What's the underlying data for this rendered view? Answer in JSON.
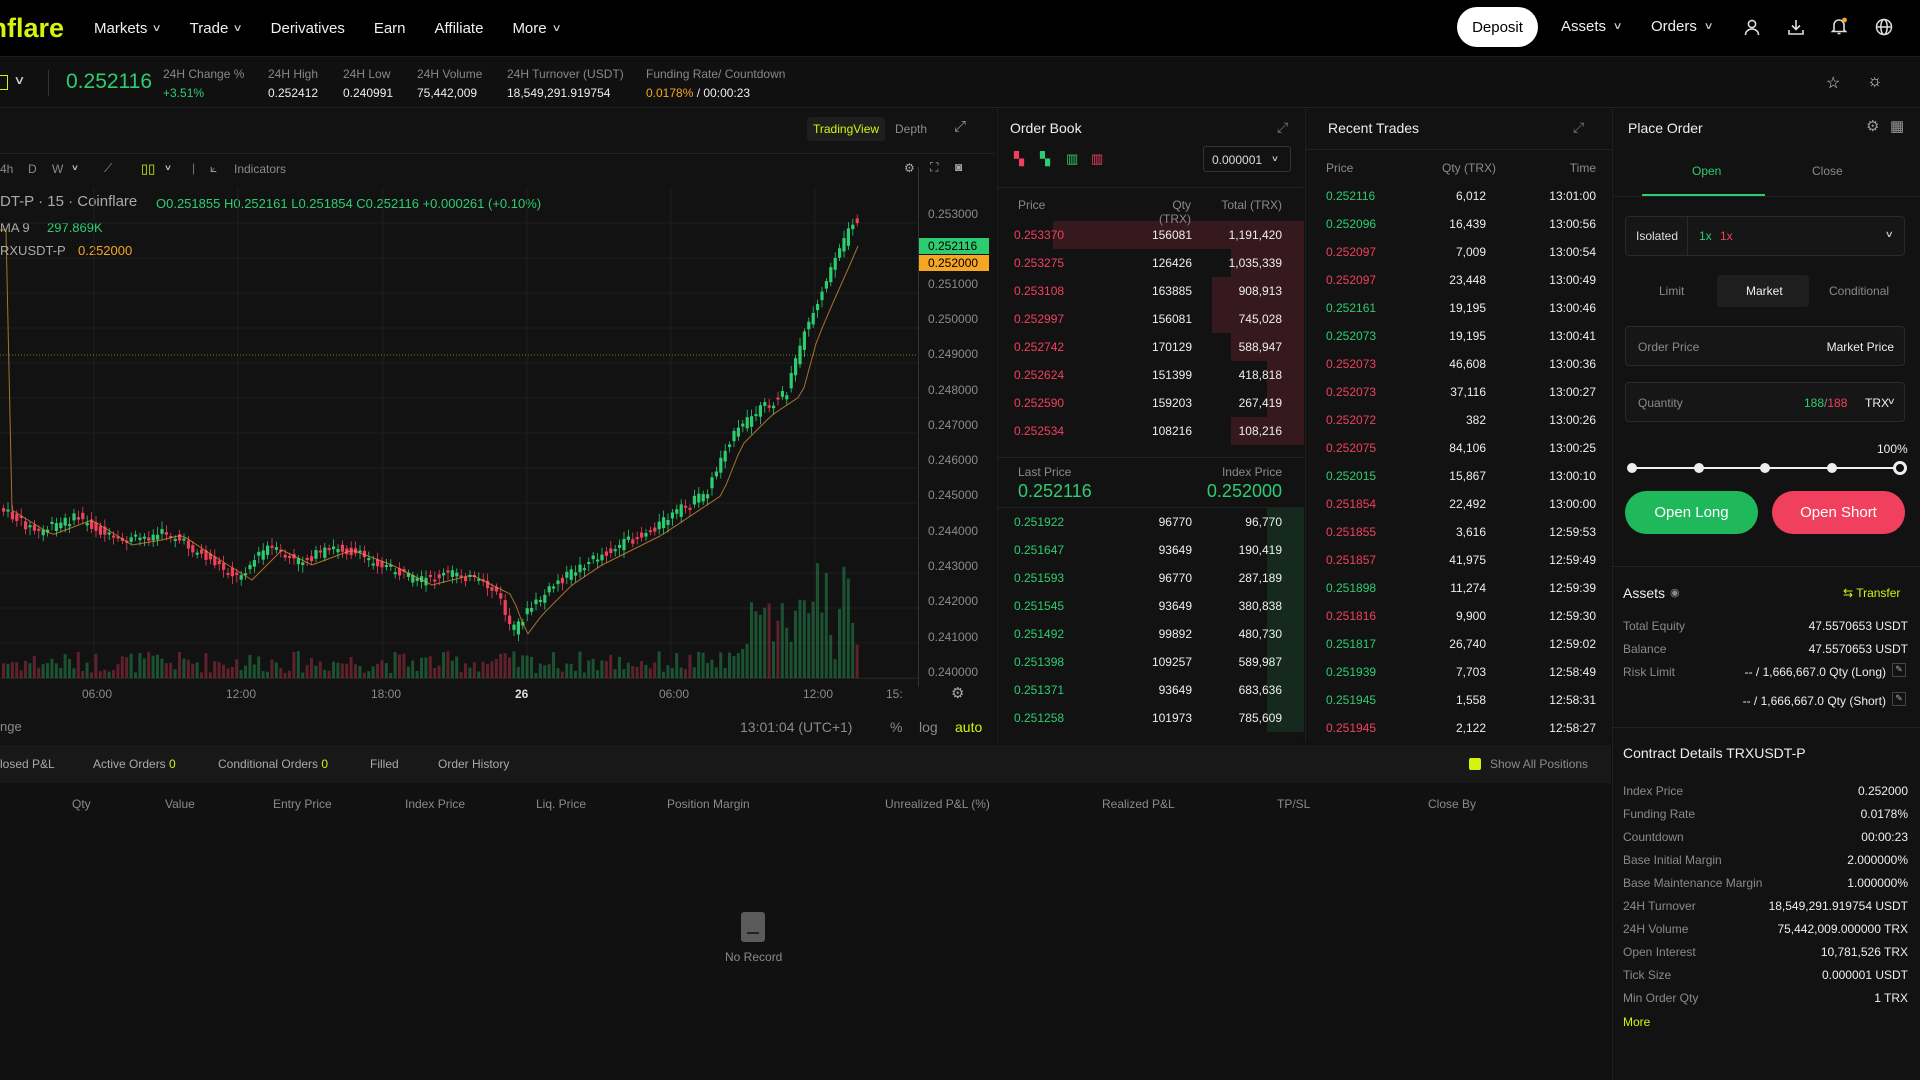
{
  "nav": {
    "logo": "Coinflare",
    "markets": "Markets",
    "trade": "Trade",
    "derivatives": "Derivatives",
    "earn": "Earn",
    "affiliate": "Affiliate",
    "more": "More",
    "deposit": "Deposit",
    "assets": "Assets",
    "orders": "Orders"
  },
  "ticker": {
    "last": "0.252116",
    "change_label": "24H Change %",
    "change": "+3.51%",
    "high_label": "24H High",
    "high": "0.252412",
    "low_label": "24H Low",
    "low": "0.240991",
    "vol_label": "24H Volume",
    "vol": "75,442,009",
    "turnover_label": "24H Turnover (USDT)",
    "turnover": "18,549,291.919754",
    "funding_label": "Funding Rate/ Countdown",
    "funding": "0.0178%",
    "countdown": "/ 00:00:23"
  },
  "chart": {
    "tab_tradingview": "TradingView",
    "tab_depth": "Depth",
    "intervals": [
      "4h",
      "D",
      "W"
    ],
    "indicators": "Indicators",
    "legend_symbol": "DT-P · 15 · Coinflare",
    "ohlc": {
      "o": "O0.251855",
      "h": "H0.252161",
      "l": "L0.251854",
      "c": "C0.252116",
      "chg": "+0.000261 (+0.10%)"
    },
    "ma_label": "MA 9",
    "ma_value": "297.869K",
    "mark_label": "RXUSDT-P",
    "mark_value": "0.252000",
    "price_ticks": [
      "0.253000",
      "0.251000",
      "0.250000",
      "0.249000",
      "0.248000",
      "0.247000",
      "0.246000",
      "0.245000",
      "0.244000",
      "0.243000",
      "0.242000",
      "0.241000",
      "0.240000"
    ],
    "last_tag": "0.252116",
    "mark_tag": "0.252000",
    "time_ticks": [
      "06:00",
      "12:00",
      "18:00",
      "26",
      "06:00",
      "12:00",
      "15:"
    ],
    "clock": "13:01:04 (UTC+1)",
    "pct": "%",
    "log": "log",
    "auto": "auto",
    "bottom_left": "nge"
  },
  "orderbook": {
    "title": "Order Book",
    "precision": "0.000001",
    "col_price": "Price",
    "col_qty": "Qty (TRX)",
    "col_total": "Total (TRX)",
    "asks": [
      {
        "p": "0.253370",
        "q": "156081",
        "t": "1,191,420",
        "d": 0.82
      },
      {
        "p": "0.253275",
        "q": "126426",
        "t": "1,035,339",
        "d": 0.24
      },
      {
        "p": "0.253108",
        "q": "163885",
        "t": "908,913",
        "d": 0.3
      },
      {
        "p": "0.252997",
        "q": "156081",
        "t": "745,028",
        "d": 0.3
      },
      {
        "p": "0.252742",
        "q": "170129",
        "t": "588,947",
        "d": 0.24
      },
      {
        "p": "0.252624",
        "q": "151399",
        "t": "418,818",
        "d": 0.12
      },
      {
        "p": "0.252590",
        "q": "159203",
        "t": "267,419",
        "d": 0.12
      },
      {
        "p": "0.252534",
        "q": "108216",
        "t": "108,216",
        "d": 0.24
      }
    ],
    "last_label": "Last Price",
    "last": "0.252116",
    "index_label": "Index Price",
    "index": "0.252000",
    "bids": [
      {
        "p": "0.251922",
        "q": "96770",
        "t": "96,770",
        "d": 0.12
      },
      {
        "p": "0.251647",
        "q": "93649",
        "t": "190,419",
        "d": 0.12
      },
      {
        "p": "0.251593",
        "q": "96770",
        "t": "287,189",
        "d": 0.12
      },
      {
        "p": "0.251545",
        "q": "93649",
        "t": "380,838",
        "d": 0.12
      },
      {
        "p": "0.251492",
        "q": "99892",
        "t": "480,730",
        "d": 0.12
      },
      {
        "p": "0.251398",
        "q": "109257",
        "t": "589,987",
        "d": 0.12
      },
      {
        "p": "0.251371",
        "q": "93649",
        "t": "683,636",
        "d": 0.12
      },
      {
        "p": "0.251258",
        "q": "101973",
        "t": "785,609",
        "d": 0.12
      }
    ]
  },
  "trades": {
    "title": "Recent Trades",
    "col_price": "Price",
    "col_qty": "Qty (TRX)",
    "col_time": "Time",
    "rows": [
      {
        "p": "0.252116",
        "q": "6,012",
        "t": "13:01:00",
        "s": "buy"
      },
      {
        "p": "0.252096",
        "q": "16,439",
        "t": "13:00:56",
        "s": "buy"
      },
      {
        "p": "0.252097",
        "q": "7,009",
        "t": "13:00:54",
        "s": "sell"
      },
      {
        "p": "0.252097",
        "q": "23,448",
        "t": "13:00:49",
        "s": "sell"
      },
      {
        "p": "0.252161",
        "q": "19,195",
        "t": "13:00:46",
        "s": "buy"
      },
      {
        "p": "0.252073",
        "q": "19,195",
        "t": "13:00:41",
        "s": "buy"
      },
      {
        "p": "0.252073",
        "q": "46,608",
        "t": "13:00:36",
        "s": "sell"
      },
      {
        "p": "0.252073",
        "q": "37,116",
        "t": "13:00:27",
        "s": "sell"
      },
      {
        "p": "0.252072",
        "q": "382",
        "t": "13:00:26",
        "s": "sell"
      },
      {
        "p": "0.252075",
        "q": "84,106",
        "t": "13:00:25",
        "s": "sell"
      },
      {
        "p": "0.252015",
        "q": "15,867",
        "t": "13:00:10",
        "s": "buy"
      },
      {
        "p": "0.251854",
        "q": "22,492",
        "t": "13:00:00",
        "s": "sell"
      },
      {
        "p": "0.251855",
        "q": "3,616",
        "t": "12:59:53",
        "s": "sell"
      },
      {
        "p": "0.251857",
        "q": "41,975",
        "t": "12:59:49",
        "s": "sell"
      },
      {
        "p": "0.251898",
        "q": "11,274",
        "t": "12:59:39",
        "s": "buy"
      },
      {
        "p": "0.251816",
        "q": "9,900",
        "t": "12:59:30",
        "s": "sell"
      },
      {
        "p": "0.251817",
        "q": "26,740",
        "t": "12:59:02",
        "s": "buy"
      },
      {
        "p": "0.251939",
        "q": "7,703",
        "t": "12:58:49",
        "s": "buy"
      },
      {
        "p": "0.251945",
        "q": "1,558",
        "t": "12:58:31",
        "s": "buy"
      },
      {
        "p": "0.251945",
        "q": "2,122",
        "t": "12:58:27",
        "s": "sell"
      }
    ]
  },
  "order": {
    "title": "Place Order",
    "tab_open": "Open",
    "tab_close": "Close",
    "margin_mode": "Isolated",
    "lev1": "1x",
    "lev2": "1x",
    "type_limit": "Limit",
    "type_market": "Market",
    "type_conditional": "Conditional",
    "price_label": "Order Price",
    "price_value": "Market Price",
    "qty_label": "Quantity",
    "qty_a": "188",
    "qty_b": "188",
    "qty_unit": "TRX",
    "slider_max": "100%",
    "slider_fraction": 1.0,
    "open_long": "Open Long",
    "open_short": "Open Short"
  },
  "assets": {
    "title": "Assets",
    "transfer": "Transfer",
    "equity_label": "Total Equity",
    "equity": "47.5570653 USDT",
    "balance_label": "Balance",
    "balance": "47.5570653 USDT",
    "risk_label": "Risk Limit",
    "risk_long": "-- / 1,666,667.0 Qty (Long)",
    "risk_short": "-- / 1,666,667.0 Qty (Short)"
  },
  "contract": {
    "title": "Contract Details TRXUSDT-P",
    "rows": [
      {
        "k": "Index Price",
        "v": "0.252000"
      },
      {
        "k": "Funding Rate",
        "v": "0.0178%"
      },
      {
        "k": "Countdown",
        "v": "00:00:23"
      },
      {
        "k": "Base Initial Margin",
        "v": "2.000000%"
      },
      {
        "k": "Base Maintenance Margin",
        "v": "1.000000%"
      },
      {
        "k": "24H Turnover",
        "v": "18,549,291.919754 USDT"
      },
      {
        "k": "24H Volume",
        "v": "75,442,009.000000 TRX"
      },
      {
        "k": "Open Interest",
        "v": "10,781,526 TRX"
      },
      {
        "k": "Tick Size",
        "v": "0.000001 USDT"
      },
      {
        "k": "Min Order Qty",
        "v": "1 TRX"
      }
    ],
    "more": "More"
  },
  "positions": {
    "tabs": [
      {
        "label": "losed P&L"
      },
      {
        "label": "Active Orders",
        "count": "0"
      },
      {
        "label": "Conditional Orders",
        "count": "0"
      },
      {
        "label": "Filled"
      },
      {
        "label": "Order History"
      }
    ],
    "show_all": "Show All Positions",
    "cols": [
      "Qty",
      "Value",
      "Entry Price",
      "Index Price",
      "Liq. Price",
      "Position Margin",
      "Unrealized P&L (%)",
      "Realized P&L",
      "TP/SL",
      "Close By"
    ],
    "empty": "No Record"
  },
  "colors": {
    "accent": "#d4f40c",
    "up": "#2ecc71",
    "down": "#f0405e"
  }
}
